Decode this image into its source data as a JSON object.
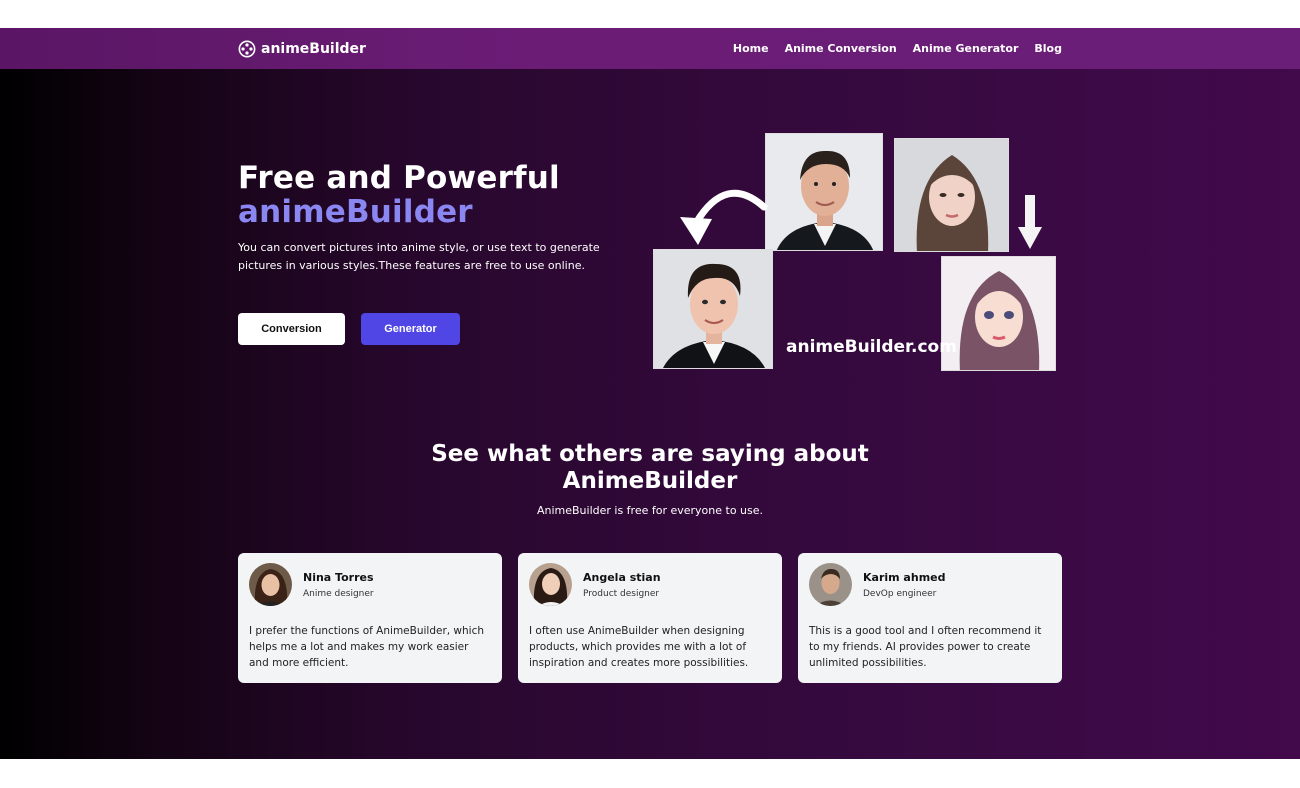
{
  "nav": {
    "brand": "animeBuilder",
    "links": [
      "Home",
      "Anime Conversion",
      "Anime Generator",
      "Blog"
    ]
  },
  "hero": {
    "title_line1": "Free and Powerful",
    "title_line2": "animeBuilder",
    "description": "You can convert pictures into anime style, or use text to generate pictures in various styles.These features are free to use online.",
    "btn_conversion": "Conversion",
    "btn_generator": "Generator",
    "collage_caption": "animeBuilder.com"
  },
  "testimonials": {
    "title": "See what others are saying about AnimeBuilder",
    "subtitle": "AnimeBuilder is free for everyone to use.",
    "cards": [
      {
        "name": "Nina Torres",
        "role": "Anime designer",
        "quote": "I prefer the functions of AnimeBuilder, which helps me a lot and makes my work easier and more efficient."
      },
      {
        "name": "Angela stian",
        "role": "Product designer",
        "quote": "I often use AnimeBuilder when designing products, which provides me with a lot of inspiration and creates more possibilities."
      },
      {
        "name": "Karim ahmed",
        "role": "DevOp engineer",
        "quote": "This is a good tool and I often recommend it to my friends. AI provides power to create unlimited possibilities."
      }
    ]
  },
  "colors": {
    "nav_bg": "#6b1d76",
    "accent": "#8b87f2",
    "primary_button": "#4f46e5"
  }
}
